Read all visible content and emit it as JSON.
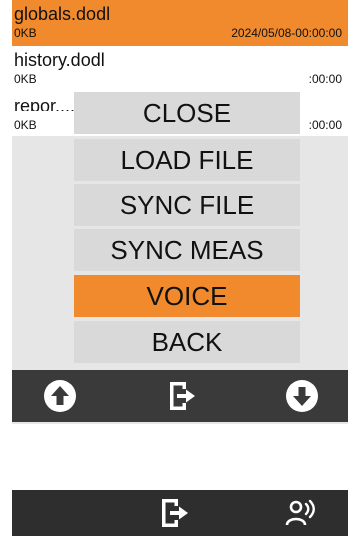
{
  "files": [
    {
      "name": "globals.dodl",
      "size": "0KB",
      "date": "2024/05/08-00:00:00",
      "selected": true
    },
    {
      "name": "history.dodl",
      "size": "0KB",
      "date": ":00:00"
    },
    {
      "name": "repor.....",
      "size": "0KB",
      "date": ":00:00"
    }
  ],
  "menu": {
    "close": "CLOSE",
    "load_file": "LOAD FILE",
    "sync_file": "SYNC FILE",
    "sync_meas": "SYNC MEAS",
    "voice": "VOICE",
    "back": "BACK"
  },
  "nav": {
    "icons": [
      "arrow-up-circle-icon",
      "file-import-icon",
      "arrow-down-circle-icon"
    ]
  },
  "bottom_bar": {
    "icons": [
      "exit-icon",
      "voice-icon"
    ]
  },
  "colors": {
    "accent": "#f08a2c",
    "screen_bg": "#e6e6e6",
    "button_bg": "#d9d9d9",
    "nav_bg": "#3a3a3a"
  }
}
